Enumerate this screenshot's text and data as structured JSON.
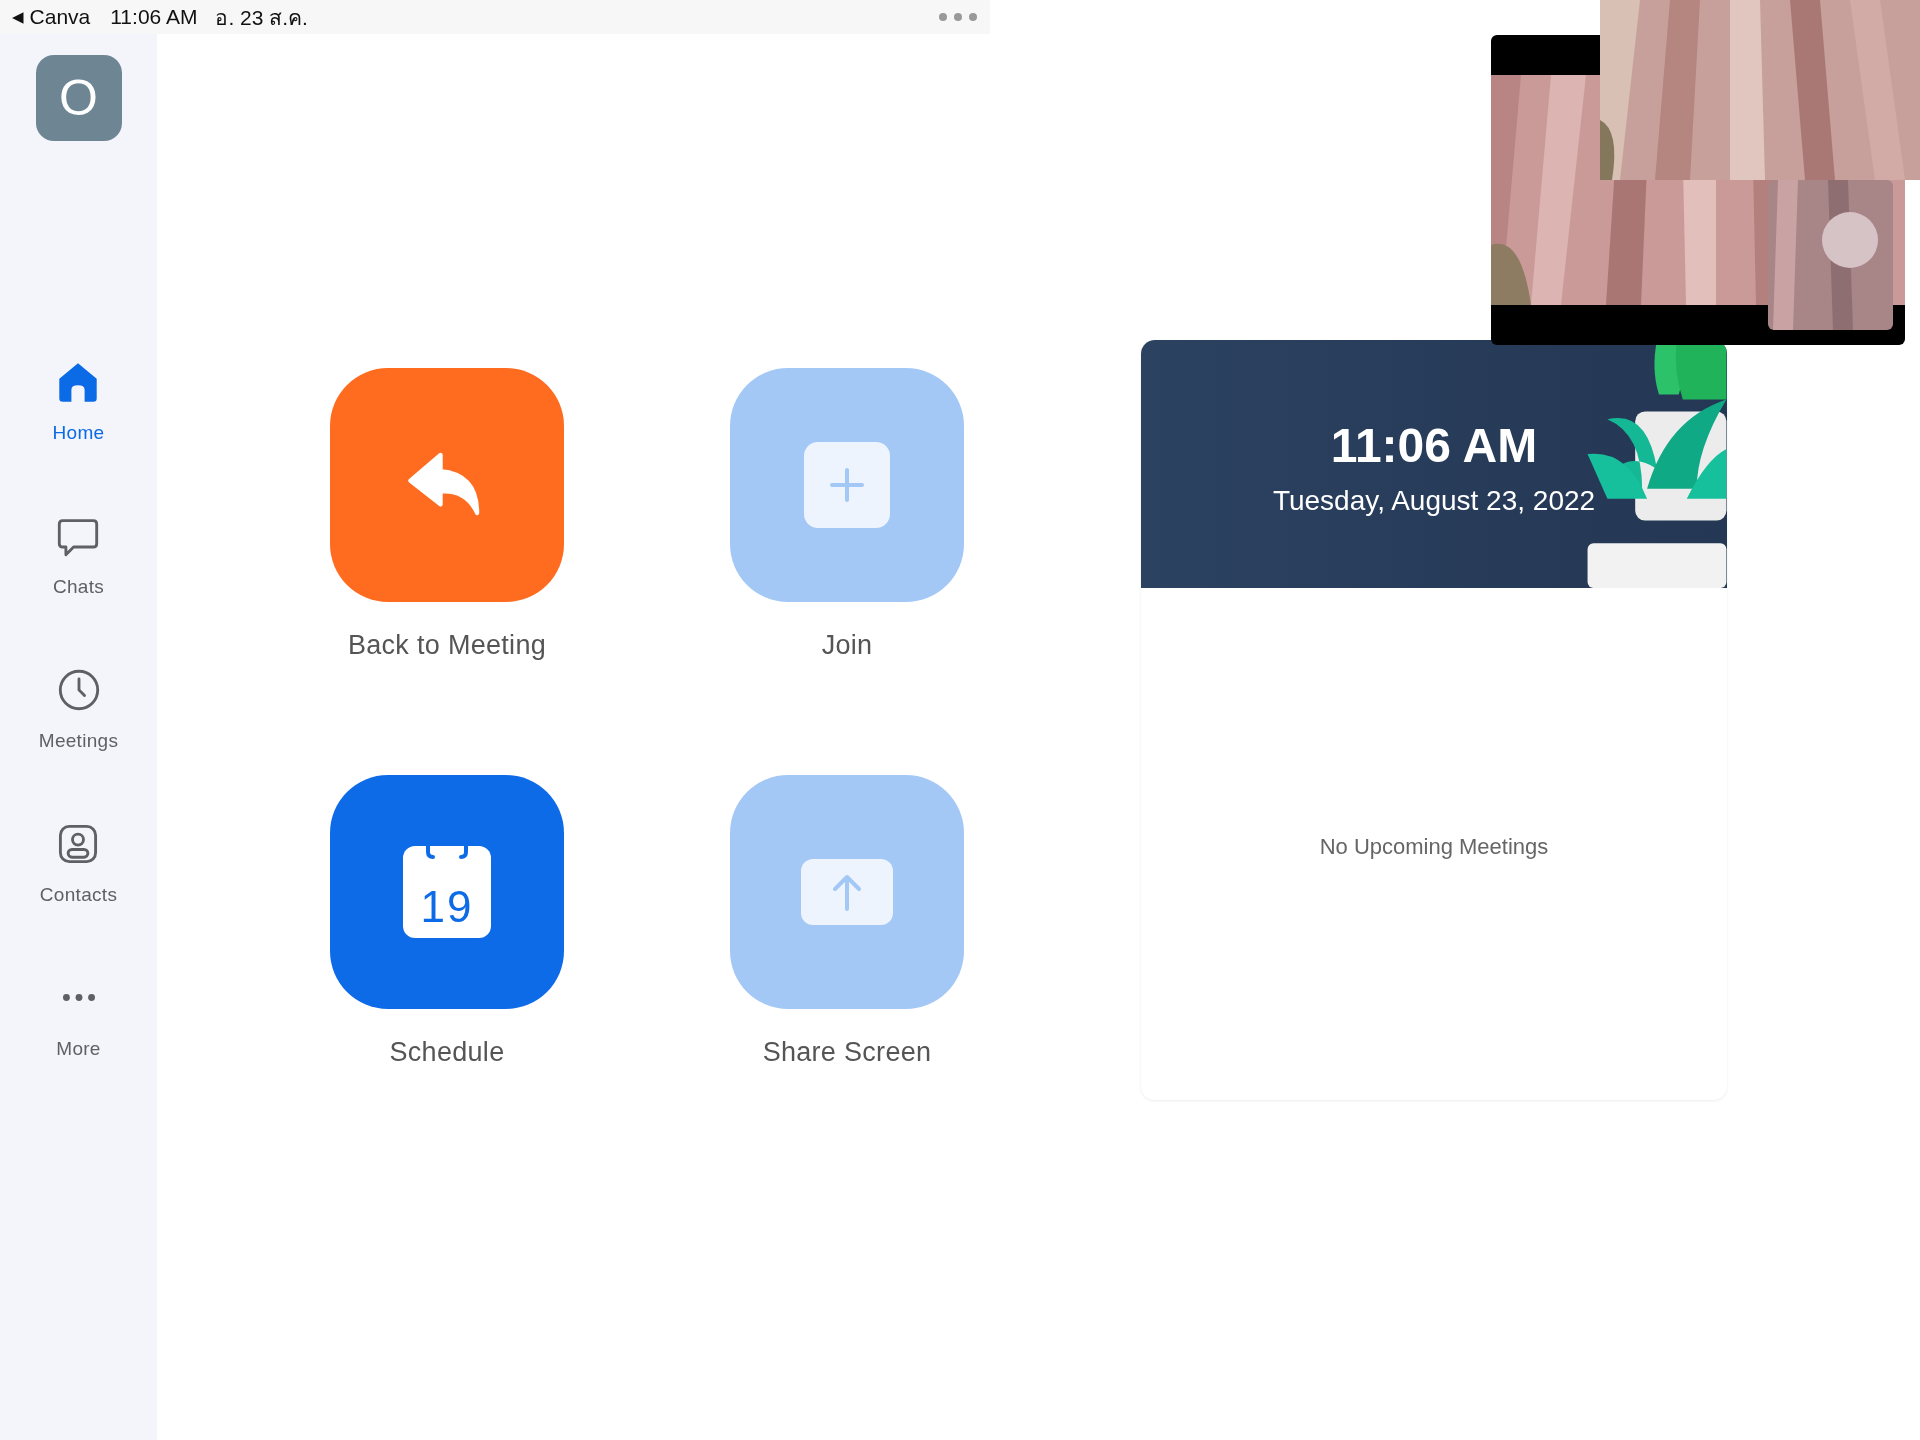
{
  "status_bar": {
    "back_arrow": "◀",
    "back_app": "Canva",
    "time": "11:06 AM",
    "date": "อ. 23 ส.ค."
  },
  "sidebar": {
    "avatar": "O",
    "items": [
      {
        "kind": "home",
        "label": "Home",
        "selected": true
      },
      {
        "kind": "chats",
        "label": "Chats",
        "selected": false
      },
      {
        "kind": "meetings",
        "label": "Meetings",
        "selected": false
      },
      {
        "kind": "contacts",
        "label": "Contacts",
        "selected": false
      },
      {
        "kind": "more",
        "label": "More",
        "selected": false
      }
    ]
  },
  "actions": [
    {
      "kind": "back",
      "label": "Back to Meeting",
      "color": "#ff6b1f"
    },
    {
      "kind": "join",
      "label": "Join",
      "color": "#a4c8f6"
    },
    {
      "kind": "schedule",
      "label": "Schedule",
      "color": "#0e6be8",
      "day": "19"
    },
    {
      "kind": "share",
      "label": "Share Screen",
      "color": "#a4c8f6"
    }
  ],
  "meetings_card": {
    "time": "11:06 AM",
    "date": "Tuesday, August 23, 2022",
    "empty_text": "No Upcoming Meetings"
  }
}
